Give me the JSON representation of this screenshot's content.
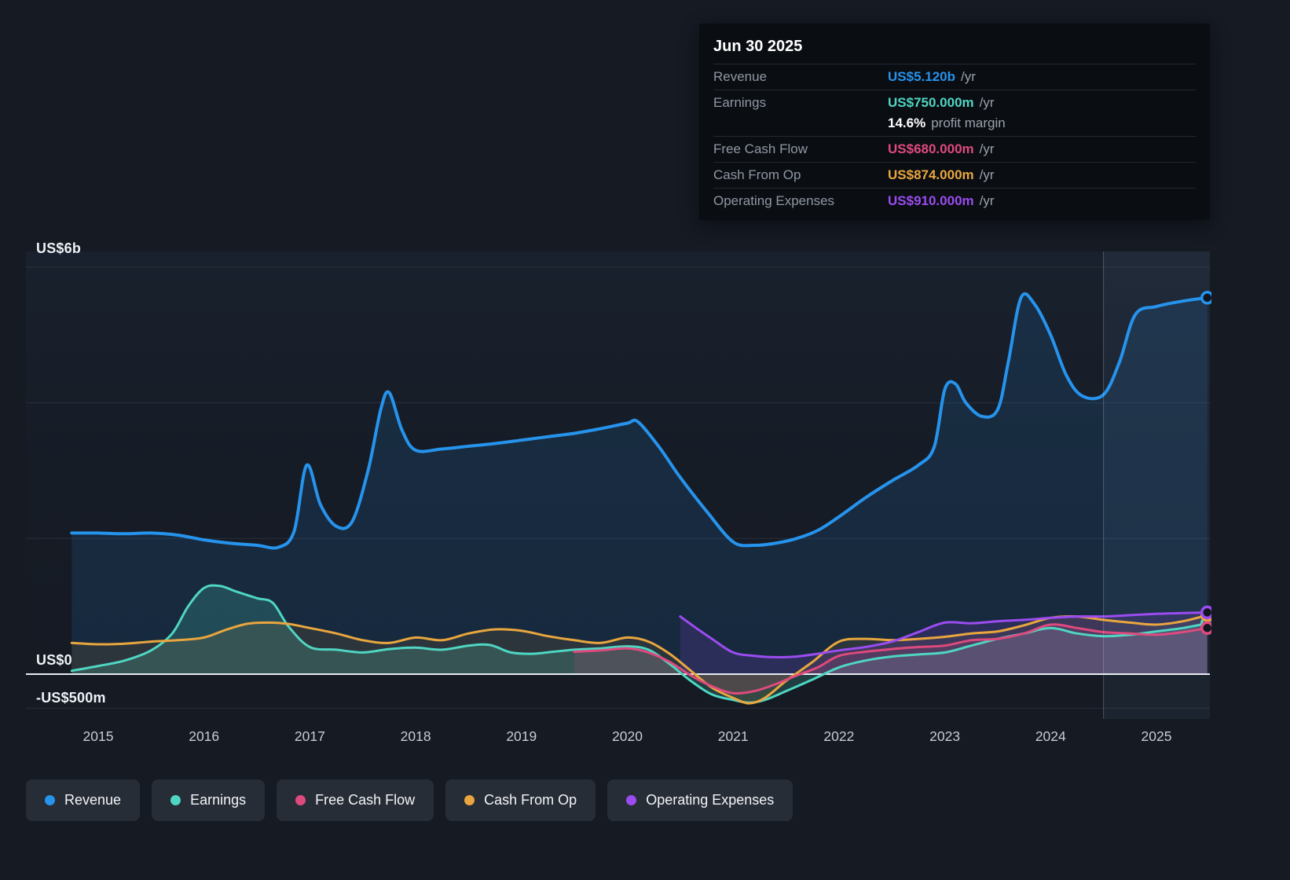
{
  "tooltip": {
    "date": "Jun 30 2025",
    "rows": [
      {
        "key": "revenue",
        "label": "Revenue",
        "value": "US$5.120b",
        "suffix": "/yr",
        "color": "#2693ec",
        "divider": true
      },
      {
        "key": "earnings",
        "label": "Earnings",
        "value": "US$750.000m",
        "suffix": "/yr",
        "color": "#4fd6c2",
        "divider": true
      },
      {
        "key": "profit-margin",
        "label": "",
        "value": "14.6%",
        "suffix": "profit margin",
        "color": "#ffffff",
        "divider": false
      },
      {
        "key": "free-cash-flow",
        "label": "Free Cash Flow",
        "value": "US$680.000m",
        "suffix": "/yr",
        "color": "#df4a7e",
        "divider": true
      },
      {
        "key": "cash-from-op",
        "label": "Cash From Op",
        "value": "US$874.000m",
        "suffix": "/yr",
        "color": "#e9a63e",
        "divider": true
      },
      {
        "key": "operating-expenses",
        "label": "Operating Expenses",
        "value": "US$910.000m",
        "suffix": "/yr",
        "color": "#9b4cf0",
        "divider": true
      }
    ]
  },
  "y_axis": {
    "top": "US$6b",
    "zero": "US$0",
    "bottom": "-US$500m"
  },
  "x_axis": {
    "labels": [
      "2015",
      "2016",
      "2017",
      "2018",
      "2019",
      "2020",
      "2021",
      "2022",
      "2023",
      "2024",
      "2025"
    ]
  },
  "legend": [
    {
      "key": "revenue",
      "label": "Revenue",
      "color": "#2693ec"
    },
    {
      "key": "earnings",
      "label": "Earnings",
      "color": "#4fd6c2"
    },
    {
      "key": "free-cash-flow",
      "label": "Free Cash Flow",
      "color": "#df4a7e"
    },
    {
      "key": "cash-from-op",
      "label": "Cash From Op",
      "color": "#e9a63e"
    },
    {
      "key": "operating-expenses",
      "label": "Operating Expenses",
      "color": "#9b4cf0"
    }
  ],
  "chart_data": {
    "type": "line",
    "x_unit": "year",
    "y_unit": "US$ billions",
    "xlim": [
      2014.7,
      2025.55
    ],
    "ylim": [
      -0.65,
      6.25
    ],
    "grid": true,
    "legend_position": "bottom-left",
    "gridlines_b": [
      6,
      4,
      2
    ],
    "zero_line_b": 0,
    "neg_gridline_b": -0.5,
    "divider_x": 2024.5,
    "series": [
      {
        "key": "revenue",
        "name": "Revenue",
        "color": "#2693ec",
        "fill_opacity": 0.13,
        "x": [
          2014.75,
          2015,
          2015.25,
          2015.5,
          2015.75,
          2016,
          2016.25,
          2016.5,
          2016.7,
          2016.85,
          2016.97,
          2017.1,
          2017.25,
          2017.4,
          2017.55,
          2017.67,
          2017.75,
          2017.87,
          2018,
          2018.25,
          2018.5,
          2018.75,
          2019,
          2019.25,
          2019.5,
          2019.75,
          2020,
          2020.1,
          2020.3,
          2020.5,
          2020.75,
          2021,
          2021.2,
          2021.4,
          2021.6,
          2021.8,
          2022,
          2022.25,
          2022.5,
          2022.75,
          2022.9,
          2023,
          2023.1,
          2023.2,
          2023.35,
          2023.5,
          2023.6,
          2023.72,
          2023.85,
          2024,
          2024.15,
          2024.3,
          2024.5,
          2024.65,
          2024.8,
          2025,
          2025.25,
          2025.48
        ],
        "values": [
          2.08,
          2.08,
          2.07,
          2.08,
          2.05,
          1.98,
          1.93,
          1.9,
          1.87,
          2.1,
          3.08,
          2.5,
          2.18,
          2.25,
          3.0,
          3.9,
          4.15,
          3.6,
          3.3,
          3.32,
          3.36,
          3.4,
          3.45,
          3.5,
          3.55,
          3.62,
          3.7,
          3.72,
          3.35,
          2.9,
          2.4,
          1.95,
          1.9,
          1.93,
          2.0,
          2.12,
          2.32,
          2.6,
          2.85,
          3.08,
          3.35,
          4.2,
          4.28,
          4.0,
          3.8,
          3.9,
          4.6,
          5.55,
          5.45,
          5.0,
          4.4,
          4.1,
          4.12,
          4.6,
          5.3,
          5.42,
          5.5,
          5.55
        ]
      },
      {
        "key": "earnings",
        "name": "Earnings",
        "color": "#4fd6c2",
        "fill_opacity": 0.2,
        "x": [
          2014.75,
          2015,
          2015.25,
          2015.5,
          2015.7,
          2015.85,
          2016,
          2016.15,
          2016.3,
          2016.5,
          2016.65,
          2016.8,
          2017,
          2017.25,
          2017.5,
          2017.75,
          2018,
          2018.25,
          2018.5,
          2018.7,
          2018.9,
          2019.1,
          2019.3,
          2019.5,
          2019.75,
          2020,
          2020.2,
          2020.4,
          2020.6,
          2020.8,
          2021,
          2021.15,
          2021.3,
          2021.5,
          2021.75,
          2022,
          2022.25,
          2022.5,
          2022.75,
          2023,
          2023.25,
          2023.5,
          2023.75,
          2024,
          2024.25,
          2024.5,
          2024.75,
          2025,
          2025.25,
          2025.48
        ],
        "values": [
          0.05,
          0.12,
          0.2,
          0.35,
          0.6,
          1.0,
          1.27,
          1.3,
          1.22,
          1.12,
          1.05,
          0.7,
          0.4,
          0.36,
          0.32,
          0.37,
          0.39,
          0.36,
          0.42,
          0.43,
          0.32,
          0.3,
          0.33,
          0.36,
          0.38,
          0.41,
          0.36,
          0.15,
          -0.1,
          -0.3,
          -0.38,
          -0.42,
          -0.38,
          -0.25,
          -0.08,
          0.1,
          0.2,
          0.26,
          0.29,
          0.32,
          0.42,
          0.52,
          0.6,
          0.68,
          0.6,
          0.56,
          0.58,
          0.63,
          0.68,
          0.75
        ]
      },
      {
        "key": "cash-from-op",
        "name": "Cash From Op",
        "color": "#e9a63e",
        "fill_opacity": 0.1,
        "x": [
          2014.75,
          2015,
          2015.25,
          2015.5,
          2015.75,
          2016,
          2016.2,
          2016.4,
          2016.6,
          2016.8,
          2017,
          2017.25,
          2017.5,
          2017.75,
          2018,
          2018.25,
          2018.5,
          2018.75,
          2019,
          2019.25,
          2019.5,
          2019.75,
          2020,
          2020.2,
          2020.4,
          2020.6,
          2020.8,
          2021,
          2021.15,
          2021.3,
          2021.5,
          2021.75,
          2022,
          2022.25,
          2022.5,
          2022.75,
          2023,
          2023.25,
          2023.5,
          2023.75,
          2024,
          2024.25,
          2024.5,
          2024.75,
          2025,
          2025.25,
          2025.48
        ],
        "values": [
          0.46,
          0.44,
          0.45,
          0.48,
          0.5,
          0.54,
          0.65,
          0.74,
          0.76,
          0.74,
          0.68,
          0.6,
          0.5,
          0.46,
          0.54,
          0.5,
          0.6,
          0.66,
          0.64,
          0.56,
          0.5,
          0.46,
          0.54,
          0.48,
          0.3,
          0.05,
          -0.2,
          -0.35,
          -0.43,
          -0.35,
          -0.1,
          0.18,
          0.48,
          0.52,
          0.5,
          0.52,
          0.55,
          0.6,
          0.63,
          0.72,
          0.83,
          0.85,
          0.8,
          0.76,
          0.73,
          0.78,
          0.87
        ]
      },
      {
        "key": "free-cash-flow",
        "name": "Free Cash Flow",
        "color": "#df4a7e",
        "fill_opacity": 0.15,
        "x": [
          2019.5,
          2019.75,
          2020,
          2020.2,
          2020.4,
          2020.6,
          2020.8,
          2021,
          2021.2,
          2021.4,
          2021.6,
          2021.8,
          2022,
          2022.25,
          2022.5,
          2022.75,
          2023,
          2023.25,
          2023.5,
          2023.75,
          2024,
          2024.25,
          2024.5,
          2024.75,
          2025,
          2025.25,
          2025.48
        ],
        "values": [
          0.33,
          0.35,
          0.38,
          0.32,
          0.18,
          -0.02,
          -0.18,
          -0.28,
          -0.25,
          -0.15,
          -0.02,
          0.1,
          0.27,
          0.33,
          0.37,
          0.4,
          0.42,
          0.5,
          0.52,
          0.6,
          0.73,
          0.68,
          0.62,
          0.6,
          0.58,
          0.62,
          0.68
        ]
      },
      {
        "key": "operating-expenses",
        "name": "Operating Expenses",
        "color": "#9b4cf0",
        "fill_opacity": 0.16,
        "x": [
          2020.5,
          2020.65,
          2020.8,
          2021,
          2021.2,
          2021.4,
          2021.6,
          2021.8,
          2022,
          2022.25,
          2022.5,
          2022.75,
          2023,
          2023.25,
          2023.5,
          2023.75,
          2024,
          2024.25,
          2024.5,
          2024.75,
          2025,
          2025.25,
          2025.48
        ],
        "values": [
          0.85,
          0.68,
          0.52,
          0.32,
          0.27,
          0.25,
          0.26,
          0.3,
          0.35,
          0.4,
          0.48,
          0.62,
          0.76,
          0.75,
          0.78,
          0.8,
          0.83,
          0.85,
          0.85,
          0.87,
          0.89,
          0.9,
          0.91
        ]
      }
    ]
  }
}
